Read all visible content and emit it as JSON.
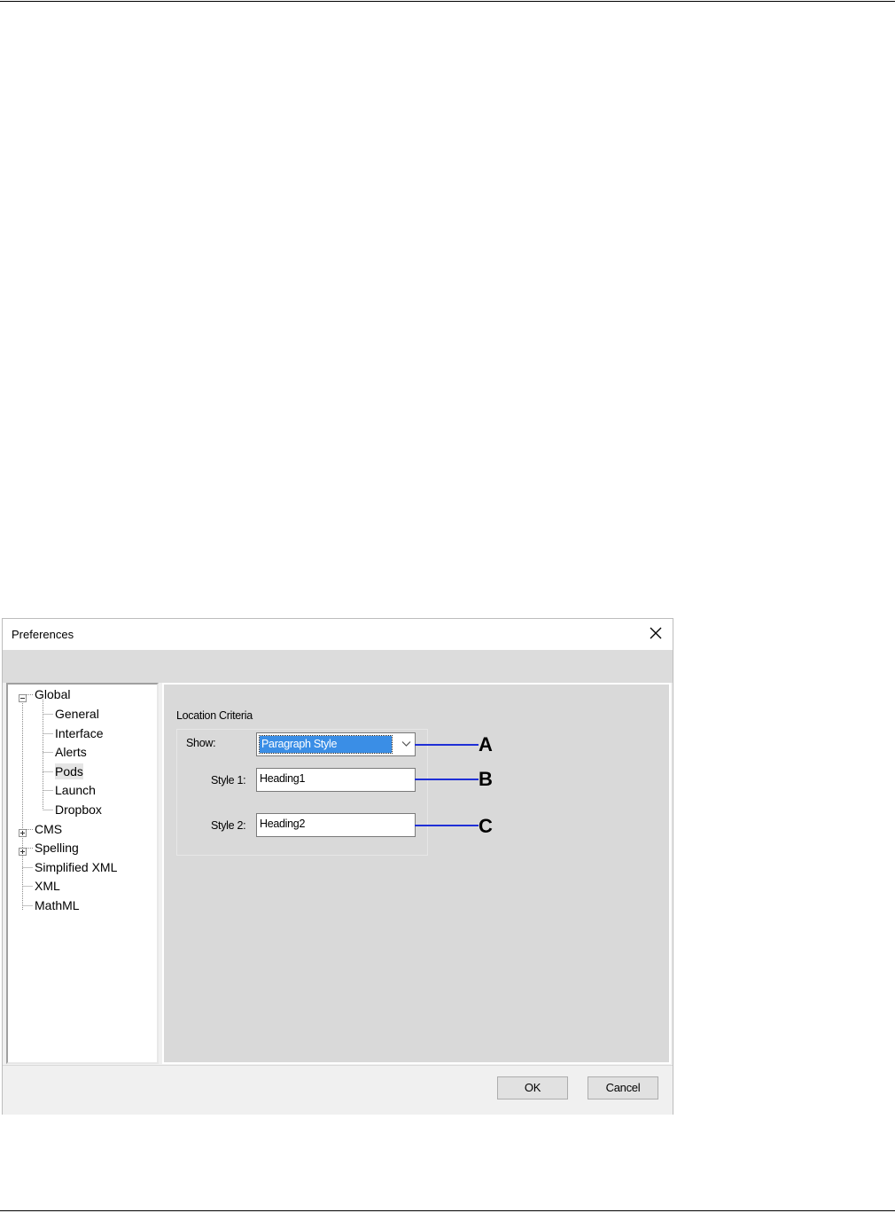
{
  "dialog": {
    "title": "Preferences",
    "close_icon": "close-icon"
  },
  "tree": {
    "items": [
      {
        "label": "Global",
        "expander": "minus"
      },
      {
        "label": "General"
      },
      {
        "label": "Interface"
      },
      {
        "label": "Alerts"
      },
      {
        "label": "Pods",
        "selected": true
      },
      {
        "label": "Launch"
      },
      {
        "label": "Dropbox"
      },
      {
        "label": "CMS",
        "expander": "plus"
      },
      {
        "label": "Spelling",
        "expander": "plus"
      },
      {
        "label": "Simplified XML"
      },
      {
        "label": "XML"
      },
      {
        "label": "MathML"
      }
    ]
  },
  "content": {
    "section_title": "Location Criteria",
    "show_label": "Show:",
    "show_value": "Paragraph Style",
    "style1_label": "Style 1:",
    "style1_value": "Heading1",
    "style2_label": "Style 2:",
    "style2_value": "Heading2"
  },
  "callouts": {
    "a": "A",
    "b": "B",
    "c": "C",
    "line_color": "#1f2fd6"
  },
  "buttons": {
    "ok": "OK",
    "cancel": "Cancel"
  }
}
